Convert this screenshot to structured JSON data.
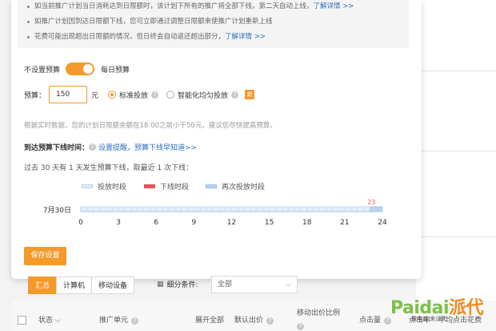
{
  "notice": {
    "items": [
      {
        "text": "如当前推广计划当日消耗达到日限额时，该计划下所有的推广将全部下线，第二天自动上线，",
        "link": "了解详情 >>"
      },
      {
        "text": "如推广计划因到达日限额下线，您可立即通过调整日限额来使推广计划重新上线",
        "link": ""
      },
      {
        "text": "花费可能出现超出日限额的情况，但日终会自动返还超出部分，",
        "link": "了解详情 >>"
      }
    ]
  },
  "budget_toggle": {
    "left_label": "不设置预算",
    "right_label": "每日预算",
    "on": true
  },
  "budget": {
    "label": "预算：",
    "value": "150",
    "unit": "元",
    "options": [
      {
        "label": "标准投放",
        "selected": true
      },
      {
        "label": "智能化均匀投放",
        "selected": false
      }
    ],
    "new_badge": "新"
  },
  "advice": "根据实时数据，您的计划日限额余额在18:00之前小于50元，建议您尽快提高预算。",
  "reminder": {
    "label": "到达预算下线时间：",
    "link": "设置提醒，预算下线早知道>>"
  },
  "history_text": "过去 30 天有 1 天发生预算下线，取最近 1 次下线：",
  "legend": [
    {
      "label": "投放时段",
      "color": "#e3eef8",
      "border": "#b8d2ec"
    },
    {
      "label": "下线时段",
      "color": "#e8505b",
      "border": "#e8505b"
    },
    {
      "label": "再次投放时段",
      "color": "#b8d4ee",
      "border": "#9cc0e4"
    }
  ],
  "chart_data": {
    "type": "timeline",
    "row_label": "7月30日",
    "x_ticks": [
      "0",
      "3",
      "6",
      "9",
      "12",
      "15",
      "18",
      "21",
      "24"
    ],
    "xlim": [
      0,
      24
    ],
    "segments": [
      {
        "type": "投放时段",
        "start": 0,
        "end": 23
      },
      {
        "type": "再次投放时段",
        "start": 23,
        "end": 24
      }
    ],
    "marker": {
      "label": "23",
      "value": 23,
      "color": "#e8505b"
    }
  },
  "save_button": "保存设置",
  "tabs": [
    "汇总",
    "计算机",
    "移动设备"
  ],
  "filter": {
    "icon": "grid-icon",
    "label": "细分条件:",
    "select_value": "全部"
  },
  "table_headers": {
    "status": "状态",
    "unit": "推广单元",
    "expand": "展开全部",
    "default_bid": "默认出价",
    "mobile_ratio": "移动出价比例",
    "clicks": "点击量",
    "ctr": "点击率",
    "avg_cost": "平均点击花费"
  },
  "watermark": {
    "brand_latin": "Paidai",
    "brand_cn": "派代",
    "sub": "做电商·来派代"
  }
}
